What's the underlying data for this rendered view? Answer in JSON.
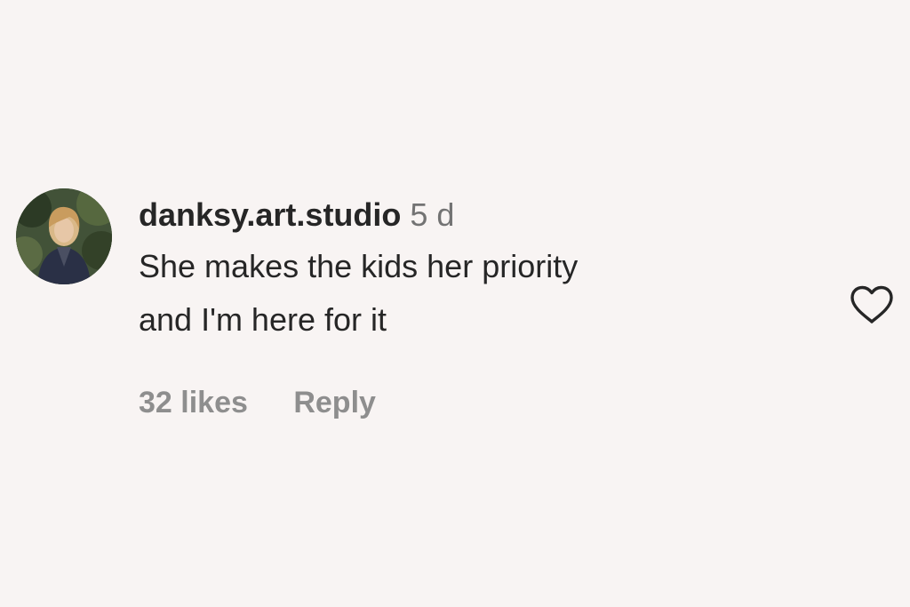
{
  "comment": {
    "username": "danksy.art.studio",
    "timestamp": "5 d",
    "text_line1": "She makes the kids her priority",
    "text_line2": "and I'm here for it",
    "likes": "32 likes",
    "reply_label": "Reply",
    "like_icon": "heart-outline-icon"
  },
  "colors": {
    "background": "#f8f4f3",
    "text_primary": "#262626",
    "text_secondary": "#8e8e8e",
    "heart_stroke": "#262626"
  }
}
